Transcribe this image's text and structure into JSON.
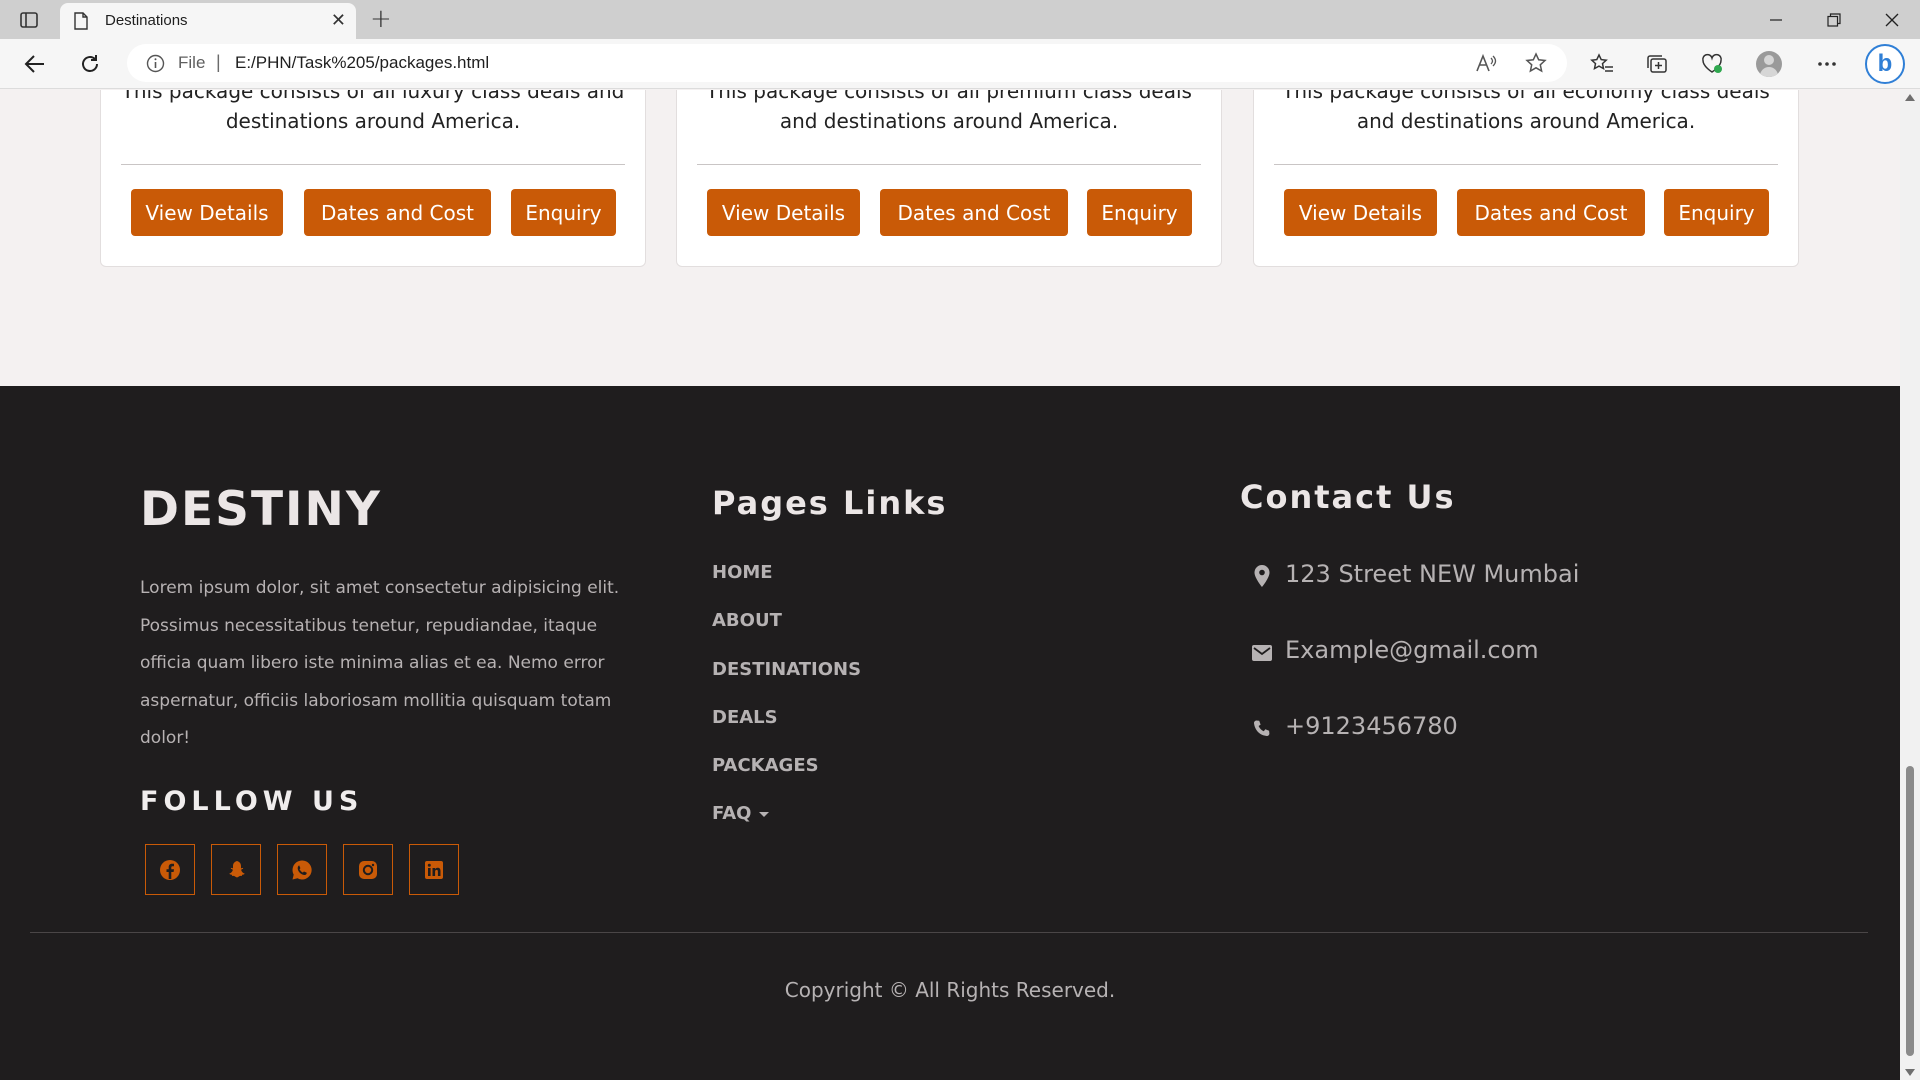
{
  "browser": {
    "tab_title": "Destinations",
    "tab_close": "✕",
    "new_tab": "+",
    "address_scheme": "File",
    "address_separator": "|",
    "url": "E:/PHN/Task%205/packages.html",
    "bing_label": "b"
  },
  "packages": [
    {
      "description": "This package consists of all luxury class deals and destinations around America.",
      "buttons": [
        "View Details",
        "Dates and Cost",
        "Enquiry"
      ]
    },
    {
      "description": "This package consists of all premium class deals and destinations around America.",
      "buttons": [
        "View Details",
        "Dates and Cost",
        "Enquiry"
      ]
    },
    {
      "description": "This package consists of all economy class deals and destinations around America.",
      "buttons": [
        "View Details",
        "Dates and Cost",
        "Enquiry"
      ]
    }
  ],
  "footer": {
    "brand": "DESTINY",
    "about": "Lorem ipsum dolor, sit amet consectetur adipisicing elit. Possimus necessitatibus tenetur, repudiandae, itaque officia quam libero iste minima alias et ea. Nemo error aspernatur, officiis laboriosam mollitia quisquam totam dolor!",
    "follow_title": "FOLLOW US",
    "social_icons": [
      "facebook-icon",
      "snapchat-icon",
      "whatsapp-icon",
      "instagram-icon",
      "linkedin-icon"
    ],
    "links_title": "Pages Links",
    "links": [
      "HOME",
      "ABOUT",
      "DESTINATIONS",
      "DEALS",
      "PACKAGES",
      "FAQ"
    ],
    "contact_title": "Contact Us",
    "contact": {
      "address": "123 Street NEW Mumbai",
      "email": "Example@gmail.com",
      "phone": "+9123456780"
    },
    "copyright": "Copyright © All Rights Reserved."
  },
  "colors": {
    "accent": "#c95a07",
    "footer_bg": "#1f1d1e",
    "page_bg": "#f4f1f1"
  }
}
